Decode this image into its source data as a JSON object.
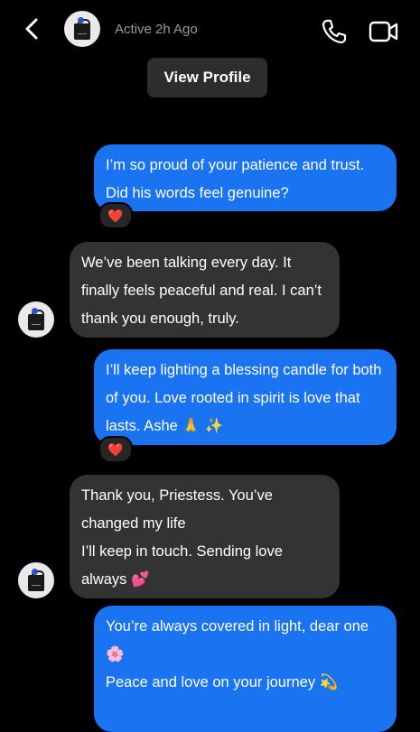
{
  "header": {
    "status": "Active 2h Ago",
    "icons": {
      "back": "chevron-left-icon",
      "call": "phone-icon",
      "video": "video-camera-icon"
    }
  },
  "view_profile_label": "View Profile",
  "messages": [
    {
      "direction": "outgoing",
      "text": "I’m so proud of your patience and trust. Did his words feel genuine?",
      "reaction": "❤️"
    },
    {
      "direction": "incoming",
      "text": "We’ve been talking every day. It finally feels peaceful and real. I can’t thank you enough, truly."
    },
    {
      "direction": "outgoing",
      "text": "I’ll keep lighting a blessing candle for both of you. Love rooted in spirit is love that lasts. Ashe 🙏 ✨",
      "reaction": "❤️"
    },
    {
      "direction": "incoming",
      "text": "Thank you, Priestess. You’ve changed my life\nI’ll keep in touch. Sending love always 💕"
    },
    {
      "direction": "outgoing",
      "text": "You’re always covered in light, dear one 🌸\nPeace and love on your journey 💫"
    }
  ],
  "colors": {
    "outgoing": "#1a73f0",
    "incoming": "#333333",
    "background": "#000000"
  }
}
